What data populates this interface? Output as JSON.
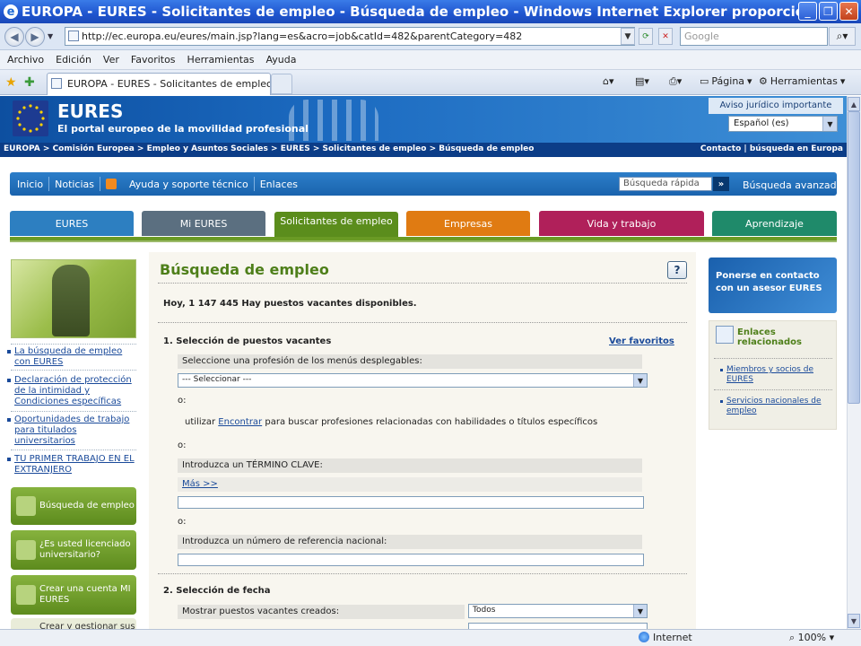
{
  "window": {
    "title": "EUROPA - EURES - Solicitantes de empleo - Búsqueda de empleo - Windows Internet Explorer proporcionado por I...",
    "minimize": "_",
    "maximize": "❐",
    "close": "✕"
  },
  "address": {
    "url": "http://ec.europa.eu/eures/main.jsp?lang=es&acro=job&catId=482&parentCategory=482",
    "search_placeholder": "Google"
  },
  "menu": [
    "Archivo",
    "Edición",
    "Ver",
    "Favoritos",
    "Herramientas",
    "Ayuda"
  ],
  "tab": {
    "label": "EUROPA - EURES - Solicitantes de empleo - ..."
  },
  "toolbar": {
    "page": "Página",
    "tools": "Herramientas"
  },
  "site": {
    "name": "EURES",
    "subtitle": "El portal europeo de la movilidad profesional",
    "legal": "Aviso jurídico importante",
    "language": "Español (es)",
    "breadcrumb": "EUROPA > Comisión Europea > Empleo y Asuntos Sociales > EURES > Solicitantes de empleo > Búsqueda de empleo",
    "contact_links": "Contacto | búsqueda en Europa"
  },
  "nav": {
    "inicio": "Inicio",
    "noticias": "Noticias",
    "ayuda": "Ayuda y soporte técnico",
    "enlaces": "Enlaces",
    "quick_search": "Búsqueda rápida",
    "go": "»",
    "advanced": "Búsqueda avanzada"
  },
  "tabs": [
    {
      "label": "EURES",
      "color": "#2d7fc1"
    },
    {
      "label": "Mi EURES",
      "color": "#5b6f80"
    },
    {
      "label": "Solicitantes de empleo",
      "color": "#5b8d1c"
    },
    {
      "label": "Empresas",
      "color": "#e07b12"
    },
    {
      "label": "Vida y trabajo",
      "color": "#b0205a"
    },
    {
      "label": "Aprendizaje",
      "color": "#1f8a6a"
    }
  ],
  "left": {
    "links": [
      "La búsqueda de empleo con EURES",
      "Declaración de protección de la intimidad y Condiciones específicas",
      "Oportunidades de trabajo para titulados universitarios",
      "TU PRIMER TRABAJO EN EL EXTRANJERO"
    ],
    "buttons": [
      "Búsqueda de empleo",
      "¿Es usted licenciado universitario?",
      "Crear una cuenta MI EURES",
      "Crear y gestionar sus"
    ]
  },
  "main": {
    "title": "Búsqueda de empleo",
    "help": "?",
    "vacancies": "Hoy, 1 147 445 Hay puestos vacantes disponibles.",
    "section1": "1. Selección de puestos vacantes",
    "favorites": "Ver favoritos",
    "select_prof": "Seleccione una profesión de los menús desplegables:",
    "select_default": "--- Seleccionar ---",
    "or": "o:",
    "use_prefix": "utilizar",
    "find": "Encontrar",
    "use_suffix": "para buscar profesiones relacionadas con habilidades o títulos específicos",
    "keyword_label": "Introduzca un TÉRMINO CLAVE:",
    "more": "Más >>",
    "ref_label": "Introduzca un número de referencia nacional:",
    "section2": "2. Selección de fecha",
    "created_label": "Mostrar puestos vacantes creados:",
    "created_value": "Todos"
  },
  "right": {
    "advisor": "Ponerse en contacto con un asesor EURES",
    "related": "Enlaces relacionados",
    "links": [
      "Miembros y socios de EURES",
      "Servicios nacionales de empleo"
    ]
  },
  "status": {
    "zone": "Internet",
    "zoom": "100%"
  }
}
